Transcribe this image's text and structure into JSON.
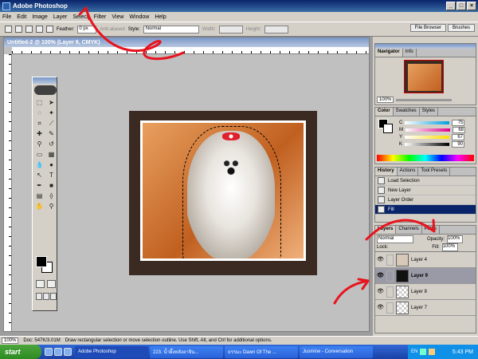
{
  "app_title": "Adobe Photoshop",
  "menu": [
    "File",
    "Edit",
    "Image",
    "Layer",
    "Select",
    "Filter",
    "View",
    "Window",
    "Help"
  ],
  "options": {
    "feather_label": "Feather:",
    "feather_value": "0 px",
    "anti_aliased": "Anti-aliased",
    "style_label": "Style:",
    "style_value": "Normal",
    "width_label": "Width:",
    "height_label": "Height:"
  },
  "well_tabs": [
    "File Browser",
    "Brushes"
  ],
  "document": {
    "title": "Untitled-2 @ 100% (Layer 9, CMYK)",
    "ruler_marks": [
      "0",
      "2",
      "4",
      "6",
      "8",
      "10",
      "12",
      "14",
      "16",
      "18",
      "20",
      "22",
      "24",
      "26",
      "28",
      "30",
      "32",
      "34",
      "36"
    ]
  },
  "navigator": {
    "tabs": [
      "Navigator",
      "Info"
    ],
    "zoom": "100%"
  },
  "color": {
    "tabs": [
      "Color",
      "Swatches",
      "Styles"
    ],
    "channels": [
      {
        "name": "C",
        "value": "75",
        "gradient": "linear-gradient(90deg,#fff,#00a0e0)"
      },
      {
        "name": "M",
        "value": "68",
        "gradient": "linear-gradient(90deg,#fff,#e0008a)"
      },
      {
        "name": "Y",
        "value": "67",
        "gradient": "linear-gradient(90deg,#fff,#ffe000)"
      },
      {
        "name": "K",
        "value": "90",
        "gradient": "linear-gradient(90deg,#fff,#000)"
      }
    ]
  },
  "history": {
    "tabs": [
      "History",
      "Actions",
      "Tool Presets"
    ],
    "items": [
      "Load Selection",
      "New Layer",
      "Layer Order",
      "Fill"
    ]
  },
  "layers": {
    "tabs": [
      "Layers",
      "Channels",
      "Paths"
    ],
    "blend_mode": "Normal",
    "opacity_label": "Opacity:",
    "opacity": "100%",
    "lock_label": "Lock:",
    "fill_label": "Fill:",
    "fill": "100%",
    "items": [
      "Layer 4",
      "Layer 9",
      "Layer 8",
      "Layer 7"
    ]
  },
  "status": {
    "zoom": "100%",
    "doc": "Doc: 547K/3.01M",
    "hint": "Draw rectangular selection or move selection outline. Use Shift, Alt, and Ctrl for additional options."
  },
  "taskbar": {
    "start": "start",
    "tasks": [
      "Adobe Photoshop",
      "223. น้ำผึ้งหลังอาจิน...",
      "ธรรมะ Dawn Of The ...",
      "Jusmine - Conversation"
    ],
    "lang": "EN",
    "clock": "5:43 PM"
  },
  "colors": {
    "annotation": "#e8141e",
    "titlebar": "#0a246a",
    "selected_layer": "#9a9aa6"
  }
}
